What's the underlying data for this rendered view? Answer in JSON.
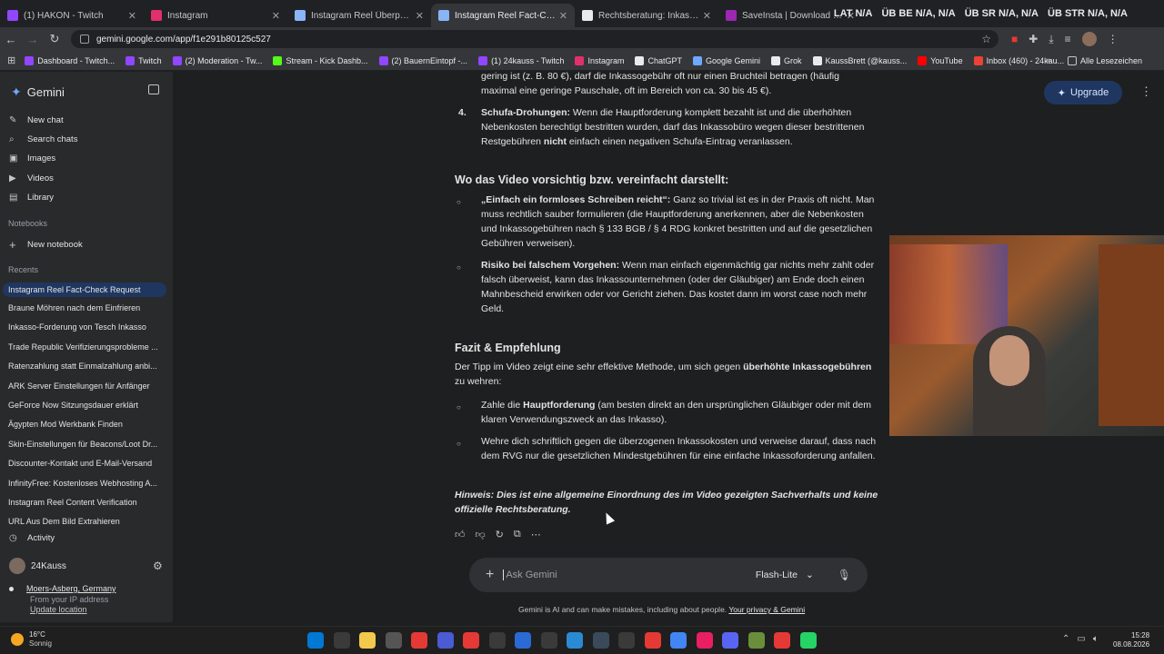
{
  "browser": {
    "tabs": [
      {
        "label": "(1) HAKON - Twitch",
        "color": "#9146ff"
      },
      {
        "label": "Instagram",
        "color": "#e1306c"
      },
      {
        "label": "Instagram Reel Überprüfung",
        "color": "#8ab4f8"
      },
      {
        "label": "Instagram Reel Fact-Check Req",
        "color": "#8ab4f8"
      },
      {
        "label": "Rechtsberatung: Inkasso-Falle v",
        "color": "#e8eaed"
      },
      {
        "label": "SaveInsta | Download Instagr",
        "color": "#9c27b0"
      }
    ],
    "ticker": [
      "LAT N/A",
      "ÜB BE N/A, N/A",
      "ÜB SR N/A, N/A",
      "ÜB STR N/A, N/A"
    ],
    "url": "gemini.google.com/app/f1e291b80125c527",
    "bookmarks": [
      {
        "label": "Dashboard - Twitch...",
        "color": "#9146ff"
      },
      {
        "label": "Twitch",
        "color": "#9146ff"
      },
      {
        "label": "(2) Moderation - Tw...",
        "color": "#9146ff"
      },
      {
        "label": "Stream - Kick Dashb...",
        "color": "#53fc18"
      },
      {
        "label": "(2) BauernEintopf -...",
        "color": "#9146ff"
      },
      {
        "label": "(1) 24kauss - Twitch",
        "color": "#9146ff"
      },
      {
        "label": "Instagram",
        "color": "#e1306c"
      },
      {
        "label": "ChatGPT",
        "color": "#e8eaed"
      },
      {
        "label": "Google Gemini",
        "color": "#6fa8ff"
      },
      {
        "label": "Grok",
        "color": "#e8eaed"
      },
      {
        "label": "KaussBrett (@kauss...",
        "color": "#e8eaed"
      },
      {
        "label": "YouTube",
        "color": "#ff0000"
      },
      {
        "label": "Inbox (460) - 24kau...",
        "color": "#ea4335"
      }
    ],
    "all_bookmarks": "Alle Lesezeichen"
  },
  "sidebar": {
    "brand": "Gemini",
    "nav": [
      {
        "label": "New chat",
        "icon": "✎"
      },
      {
        "label": "Search chats",
        "icon": "⌕"
      },
      {
        "label": "Images",
        "icon": "▣"
      },
      {
        "label": "Videos",
        "icon": "▶"
      },
      {
        "label": "Library",
        "icon": "▤"
      }
    ],
    "notebooks_header": "Notebooks",
    "new_notebook": "New notebook",
    "recents_header": "Recents",
    "recents": [
      "Instagram Reel Fact-Check Request",
      "Braune Möhren nach dem Einfrieren",
      "Inkasso-Forderung von Tesch Inkasso",
      "Trade Republic Verifizierungsprobleme ...",
      "Ratenzahlung statt Einmalzahlung anbi...",
      "ARK Server Einstellungen für Anfänger",
      "GeForce Now Sitzungsdauer erklärt",
      "Ägypten Mod Werkbank Finden",
      "Skin-Einstellungen für Beacons/Loot Dr...",
      "Discounter-Kontakt und E-Mail-Versand",
      "InfinityFree: Kostenloses Webhosting A...",
      "Instagram Reel Content Verification",
      "URL Aus Dem Bild Extrahieren"
    ],
    "activity": "Activity",
    "user": "24Kauss",
    "location": "Moers-Asberg, Germany",
    "location_sub": "From your IP address",
    "update_location": "Update location"
  },
  "header": {
    "upgrade": "Upgrade"
  },
  "chat": {
    "top_fragment_1": "gering ist (z. B. 80 €), darf die Inkassogebühr oft nur einen Bruchteil betragen (häufig",
    "top_fragment_2": "maximal eine geringe Pauschale, oft im Bereich von ca. 30 bis 45 €).",
    "item4_num": "4.",
    "item4_bold": "Schufa-Drohungen:",
    "item4_text": " Wenn die Hauptforderung komplett bezahlt ist und die überhöhten Nebenkosten berechtigt bestritten wurden, darf das Inkassobüro wegen dieser bestrittenen Restgebühren ",
    "item4_bold2": "nicht",
    "item4_text2": " einfach einen negativen Schufa-Eintrag veranlassen.",
    "h_video": "Wo das Video vorsichtig bzw. vereinfacht darstellt:",
    "v1_bold": "„Einfach ein formloses Schreiben reicht“:",
    "v1_text": " Ganz so trivial ist es in der Praxis oft nicht. Man muss rechtlich sauber formulieren (die Hauptforderung anerkennen, aber die Nebenkosten und Inkassogebühren nach § 133 BGB / § 4 RDG konkret bestritten und auf die gesetzlichen Gebühren verweisen).",
    "v2_bold": "Risiko bei falschem Vorgehen:",
    "v2_text": " Wenn man einfach eigenmächtig gar nichts mehr zahlt oder falsch überweist, kann das Inkassounternehmen (oder der Gläubiger) am Ende doch einen Mahnbescheid erwirken oder vor Gericht ziehen. Das kostet dann im worst case noch mehr Geld.",
    "h_fazit": "Fazit & Empfehlung",
    "fazit_text": "Der Tipp im Video zeigt eine sehr effektive Methode, um sich gegen ",
    "fazit_bold": "überhöhte Inkassogebühren",
    "fazit_text2": " zu wehren:",
    "f1_text": "Zahle die ",
    "f1_bold": "Hauptforderung",
    "f1_text2": " (am besten direkt an den ursprünglichen Gläubiger oder mit dem klaren Verwendungszweck an das Inkasso).",
    "f2_text": "Wehre dich schriftlich gegen die überzogenen Inkassokosten und verweise darauf, dass nach dem RVG nur die gesetzlichen Mindestgebühren für eine einfache Inkassoforderung anfallen.",
    "hinweis": "Hinweis: Dies ist eine allgemeine Einordnung des im Video gezeigten Sachverhalts und keine offizielle Rechtsberatung."
  },
  "composer": {
    "placeholder": "Ask Gemini",
    "model": "Flash-Lite"
  },
  "disclaimer": {
    "text": "Gemini is AI and can make mistakes, including about people. ",
    "link": "Your privacy & Gemini"
  },
  "taskbar": {
    "temp": "16°C",
    "weather": "Sonnig",
    "time": "15:28",
    "date": "08.08.2026",
    "apps": [
      "#0078d4",
      "#3a3a3a",
      "#f2c94c",
      "#555",
      "#e53935",
      "#4a5bd4",
      "#e53935",
      "#3a3a3a",
      "#2a6ad4",
      "#3a3a3a",
      "#2a8ad4",
      "#3a4a5a",
      "#3a3a3a",
      "#e53935",
      "#4285f4",
      "#e91e63",
      "#5865f2",
      "#6a8f3a",
      "#e53935",
      "#25d366"
    ]
  }
}
